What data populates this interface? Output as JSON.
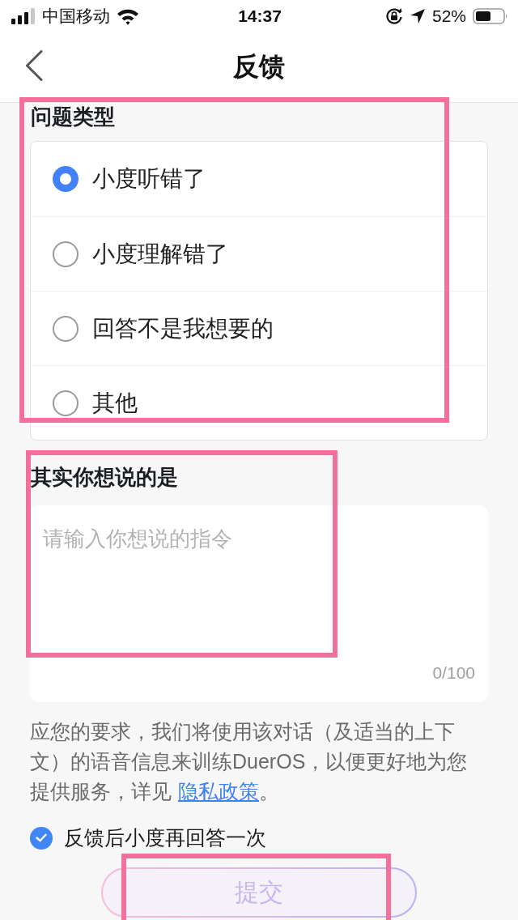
{
  "status_bar": {
    "carrier": "中国移动",
    "time": "14:37",
    "battery": "52%"
  },
  "nav": {
    "title": "反馈"
  },
  "question_type": {
    "title": "问题类型",
    "options": [
      {
        "label": "小度听错了",
        "selected": true
      },
      {
        "label": "小度理解错了",
        "selected": false
      },
      {
        "label": "回答不是我想要的",
        "selected": false
      },
      {
        "label": "其他",
        "selected": false
      }
    ]
  },
  "input_section": {
    "title": "其实你想说的是",
    "placeholder": "请输入你想说的指令",
    "counter": "0/100"
  },
  "notice": {
    "text": "应您的要求，我们将使用该对话（及适当的上下文）的语音信息来训练DuerOS，以便更好地为您提供服务，详见",
    "link": "隐私政策",
    "end": "。"
  },
  "reanswer": {
    "label": "反馈后小度再回答一次",
    "checked": true
  },
  "submit": {
    "label": "提交",
    "disabled": true
  }
}
